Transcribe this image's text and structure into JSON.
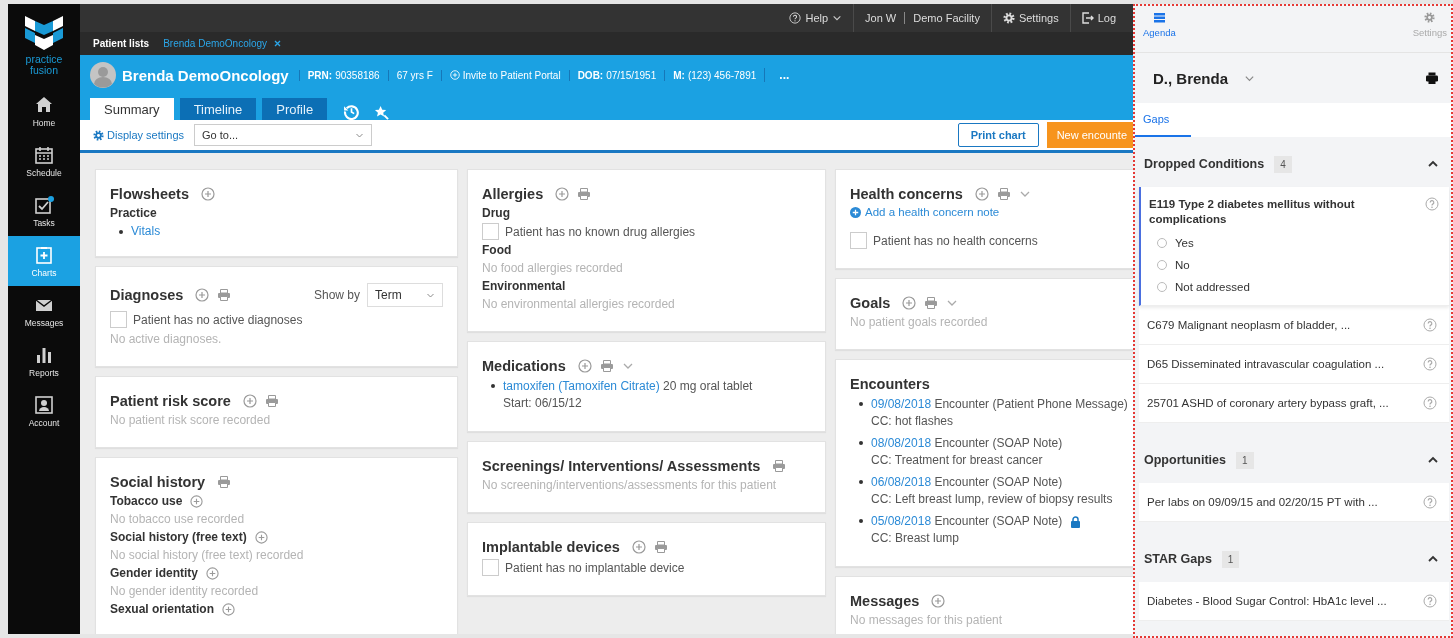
{
  "nav": {
    "logo_text": "practice fusion",
    "items": [
      {
        "label": "Home",
        "kind": "home",
        "selected": false
      },
      {
        "label": "Schedule",
        "kind": "schedule",
        "selected": false
      },
      {
        "label": "Tasks",
        "kind": "tasks",
        "selected": false
      },
      {
        "label": "Charts",
        "kind": "charts",
        "selected": true
      },
      {
        "label": "Messages",
        "kind": "messages",
        "selected": false
      },
      {
        "label": "Reports",
        "kind": "reports",
        "selected": false
      },
      {
        "label": "Account",
        "kind": "account",
        "selected": false
      }
    ]
  },
  "top_bar": {
    "help": "Help",
    "user": "Jon W",
    "facility": "Demo Facility",
    "settings": "Settings",
    "logout": "Log"
  },
  "patient_tabs": [
    {
      "label": "Patient lists",
      "selected": false,
      "closable": false
    },
    {
      "label": "Brenda DemoOncology",
      "selected": true,
      "closable": true
    }
  ],
  "patient": {
    "name": "Brenda DemoOncology",
    "fields": [
      {
        "kind": "labeled",
        "label": "PRN:",
        "value": "90358186"
      },
      {
        "kind": "plain",
        "value": "67 yrs F"
      },
      {
        "kind": "action",
        "value": "Invite to Patient Portal"
      },
      {
        "kind": "labeled",
        "label": "DOB:",
        "value": "07/15/1951"
      },
      {
        "kind": "labeled",
        "label": "M:",
        "value": "(123) 456-7891"
      }
    ],
    "more": "..."
  },
  "chart_tabs": [
    {
      "label": "Summary",
      "selected": true
    },
    {
      "label": "Timeline",
      "selected": false
    },
    {
      "label": "Profile",
      "selected": false
    }
  ],
  "toolbar": {
    "display_settings": "Display settings",
    "goto": "Go to...",
    "print_button": "Print chart",
    "new_button": "New encounte"
  },
  "columns": [
    [
      {
        "title": "Flowsheets",
        "add": true,
        "print": false,
        "dropdown": false,
        "items": [
          {
            "kind": "subheading",
            "text": "Practice",
            "add": false
          },
          {
            "kind": "link",
            "text": "Vitals"
          }
        ]
      },
      {
        "title": "Diagnoses",
        "add": true,
        "print": true,
        "dropdown": false,
        "show_by": {
          "label": "Show by",
          "value": "Term"
        },
        "items": [
          {
            "kind": "checkbox",
            "text": "Patient has no active diagnoses",
            "checked": false
          },
          {
            "kind": "note",
            "text": "No active diagnoses."
          }
        ]
      },
      {
        "title": "Patient risk score",
        "add": true,
        "print": true,
        "dropdown": false,
        "items": [
          {
            "kind": "note",
            "text": "No patient risk score recorded"
          }
        ]
      },
      {
        "title": "Social history",
        "add": false,
        "print": true,
        "dropdown": false,
        "items": [
          {
            "kind": "subheading",
            "text": "Tobacco use",
            "add": true
          },
          {
            "kind": "note",
            "text": "No tobacco use recorded"
          },
          {
            "kind": "subheading",
            "text": "Social history (free text)",
            "add": true
          },
          {
            "kind": "note",
            "text": "No social history (free text) recorded"
          },
          {
            "kind": "subheading",
            "text": "Gender identity",
            "add": true
          },
          {
            "kind": "note",
            "text": "No gender identity recorded"
          },
          {
            "kind": "subheading",
            "text": "Sexual orientation",
            "add": true
          }
        ]
      }
    ],
    [
      {
        "title": "Allergies",
        "add": true,
        "print": true,
        "dropdown": false,
        "items": [
          {
            "kind": "subheading",
            "text": "Drug",
            "add": false
          },
          {
            "kind": "checkbox",
            "text": "Patient has no known drug allergies",
            "checked": false
          },
          {
            "kind": "subheading",
            "text": "Food",
            "add": false
          },
          {
            "kind": "note",
            "text": "No food allergies recorded"
          },
          {
            "kind": "subheading",
            "text": "Environmental",
            "add": false
          },
          {
            "kind": "note",
            "text": "No environmental allergies recorded"
          }
        ]
      },
      {
        "title": "Medications",
        "add": true,
        "print": true,
        "dropdown": true,
        "items": [
          {
            "kind": "medication",
            "link": "tamoxifen (Tamoxifen Citrate)",
            "text": "20 mg oral tablet",
            "start": "Start: 06/15/12"
          }
        ]
      },
      {
        "title": "Screenings/ Interventions/ Assessments",
        "add": false,
        "print": true,
        "dropdown": false,
        "items": [
          {
            "kind": "note",
            "text": "No screening/interventions/assessments for this patient"
          }
        ]
      },
      {
        "title": "Implantable devices",
        "add": true,
        "print": true,
        "dropdown": false,
        "items": [
          {
            "kind": "checkbox",
            "text": "Patient has no implantable device",
            "checked": false
          }
        ]
      }
    ],
    [
      {
        "title": "Health concerns",
        "add": true,
        "print": true,
        "dropdown": true,
        "items": [
          {
            "kind": "action",
            "text": "Add a health concern note"
          },
          {
            "kind": "checkbox",
            "text": "Patient has no health concerns",
            "checked": false
          }
        ]
      },
      {
        "title": "Goals",
        "add": true,
        "print": true,
        "dropdown": true,
        "items": [
          {
            "kind": "note",
            "text": "No patient goals recorded"
          }
        ]
      },
      {
        "title": "Encounters",
        "add": false,
        "print": false,
        "dropdown": false,
        "items": [
          {
            "kind": "encounter",
            "date": "09/08/2018",
            "text": "Encounter (Patient Phone Message)",
            "cc": "CC: hot flashes",
            "locked": false
          },
          {
            "kind": "encounter",
            "date": "08/08/2018",
            "text": "Encounter (SOAP Note)",
            "cc": "CC: Treatment for breast cancer",
            "locked": false
          },
          {
            "kind": "encounter",
            "date": "06/08/2018",
            "text": "Encounter (SOAP Note)",
            "cc": "CC: Left breast lump, review of biopsy results",
            "locked": false
          },
          {
            "kind": "encounter",
            "date": "05/08/2018",
            "text": "Encounter (SOAP Note)",
            "cc": "CC: Breast lump",
            "locked": true
          }
        ]
      },
      {
        "title": "Messages",
        "add": true,
        "print": false,
        "dropdown": false,
        "items": [
          {
            "kind": "note",
            "text": "No messages for this patient"
          }
        ]
      }
    ]
  ],
  "agenda": {
    "nav": [
      {
        "label": "Agenda",
        "kind": "agenda",
        "selected": true
      },
      {
        "label": "Settings",
        "kind": "settings",
        "selected": false
      }
    ],
    "patient": "D., Brenda",
    "tabs": [
      {
        "label": "Gaps",
        "selected": true
      }
    ],
    "sections": [
      {
        "title": "Dropped Conditions",
        "count": "4",
        "expanded": true,
        "items": [
          {
            "text": "E119 Type 2 diabetes mellitus without complications",
            "expanded": true,
            "options": [
              {
                "label": "Yes",
                "selected": false
              },
              {
                "label": "No",
                "selected": false
              },
              {
                "label": "Not addressed",
                "selected": false
              }
            ]
          },
          {
            "text": "C679 Malignant neoplasm of bladder, ...",
            "expanded": false
          },
          {
            "text": "D65 Disseminated intravascular coagulation ...",
            "expanded": false
          },
          {
            "text": "25701 ASHD of coronary artery bypass graft, ...",
            "expanded": false
          }
        ]
      },
      {
        "title": "Opportunities",
        "count": "1",
        "expanded": true,
        "items": [
          {
            "text": "Per labs on 09/09/15 and 02/20/15 PT with ...",
            "expanded": false
          }
        ]
      },
      {
        "title": "STAR Gaps",
        "count": "1",
        "expanded": true,
        "items": [
          {
            "text": "Diabetes - Blood Sugar Control: HbA1c level ...",
            "expanded": false
          }
        ]
      }
    ]
  }
}
